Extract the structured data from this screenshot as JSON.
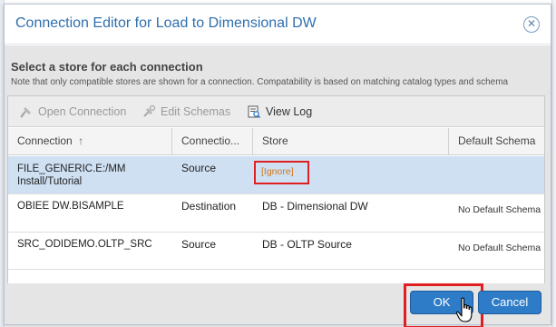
{
  "dialog": {
    "title": "Connection Editor for Load to Dimensional DW",
    "heading": "Select a store for each connection",
    "note": "Note that only compatible stores are shown for a connection. Compatability is based on matching catalog types and schema"
  },
  "toolbar": {
    "open_connection": "Open Connection",
    "edit_schemas": "Edit Schemas",
    "view_log": "View Log"
  },
  "table": {
    "headers": [
      "Connection",
      "Connectio...",
      "Store",
      "Default Schema"
    ],
    "sort_indicator": "↑",
    "rows": [
      {
        "connection_line1": "FILE_GENERIC.E:/MM",
        "connection_line2": "Install/Tutorial",
        "direction": "Source",
        "store": "[Ignore]",
        "default_schema": ""
      },
      {
        "connection": "OBIEE DW.BISAMPLE",
        "direction": "Destination",
        "store": "DB - Dimensional DW",
        "default_schema": "No Default Schema"
      },
      {
        "connection": "SRC_ODIDEMO.OLTP_SRC",
        "direction": "Source",
        "store": "DB - OLTP Source",
        "default_schema": "No Default Schema"
      }
    ]
  },
  "buttons": {
    "ok": "OK",
    "cancel": "Cancel"
  },
  "colors": {
    "accent": "#2e7cc8",
    "title": "#2f6fae",
    "highlight": "#e02020",
    "ignore_link": "#d2761a",
    "selected_row": "#cfe0f3"
  },
  "icons": [
    "close-icon",
    "open-connection-icon",
    "edit-schemas-icon",
    "view-log-icon",
    "sort-ascending-icon",
    "hand-cursor-icon"
  ]
}
